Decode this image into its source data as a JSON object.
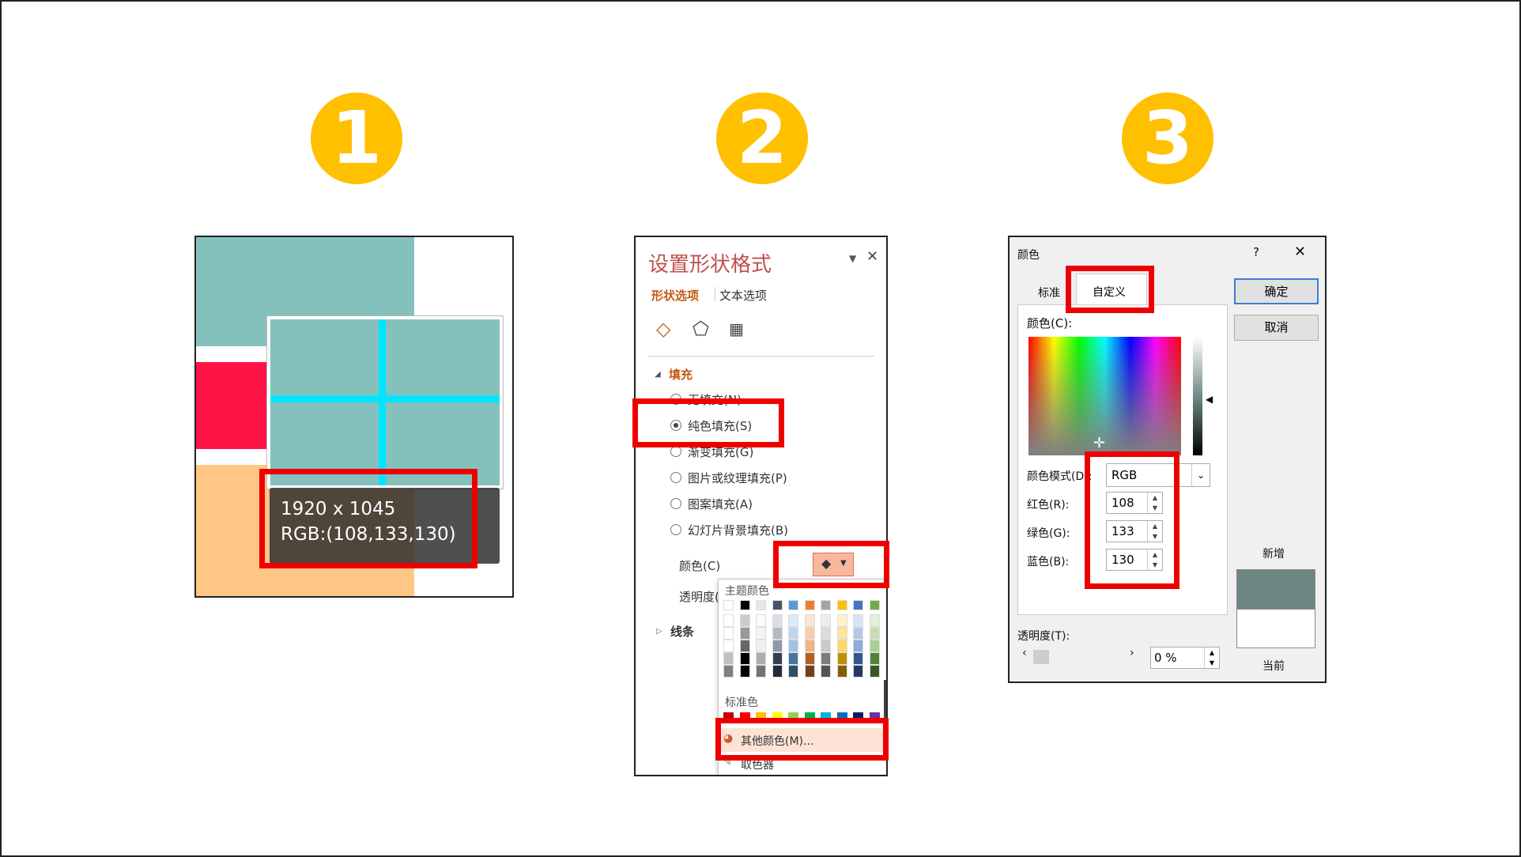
{
  "steps": [
    "1",
    "2",
    "3"
  ],
  "panel1": {
    "size_text": "1920 x 1045",
    "rgb_text": "RGB:(108,133,130)"
  },
  "panel2": {
    "title": "设置形状格式",
    "tab_shape": "形状选项",
    "tab_text": "文本选项",
    "section_fill": "填充",
    "fill_options": [
      "无填充(N)",
      "纯色填充(S)",
      "渐变填充(G)",
      "图片或纹理填充(P)",
      "图案填充(A)",
      "幻灯片背景填充(B)"
    ],
    "color_label": "颜色(C)",
    "transparency_label": "透明度(",
    "section_line": "线条",
    "theme_colors_label": "主题颜色",
    "standard_colors_label": "标准色",
    "more_colors": "其他颜色(M)...",
    "eyedropper": "取色器",
    "theme_top_row": [
      "#ffffff",
      "#000000",
      "#e7e6e6",
      "#44546a",
      "#5b9bd5",
      "#ed7d31",
      "#a5a5a5",
      "#ffc000",
      "#4472c4",
      "#70ad47"
    ],
    "standard_row": [
      "#c00000",
      "#ff0000",
      "#ffc000",
      "#ffff00",
      "#92d050",
      "#00b050",
      "#00b0f0",
      "#0070c0",
      "#002060",
      "#7030a0"
    ]
  },
  "panel3": {
    "title": "颜色",
    "help": "?",
    "tab_standard": "标准",
    "tab_custom": "自定义",
    "ok": "确定",
    "cancel": "取消",
    "colors_label": "颜色(C):",
    "mode_label": "颜色模式(D):",
    "mode_value": "RGB",
    "red_label": "红色(R):",
    "red_value": "108",
    "green_label": "绿色(G):",
    "green_value": "133",
    "blue_label": "蓝色(B):",
    "blue_value": "130",
    "transparency_label": "透明度(T):",
    "transparency_value": "0 %",
    "new_label": "新增",
    "current_label": "当前",
    "new_color": "#6c8582"
  }
}
